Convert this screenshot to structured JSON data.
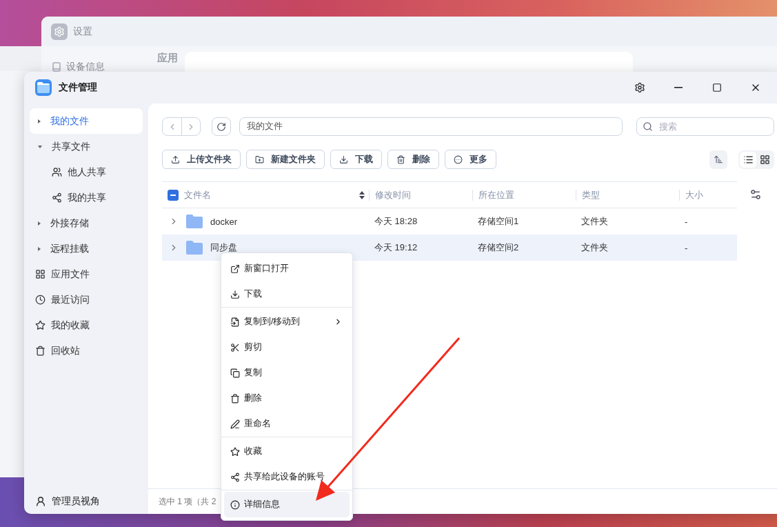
{
  "background_window": {
    "title": "设置",
    "sidebar_item": "设备信息",
    "heading": "应用"
  },
  "window": {
    "title": "文件管理"
  },
  "sidebar": {
    "items": [
      {
        "label": "我的文件",
        "kind": "group",
        "selected": true,
        "expanded": false
      },
      {
        "label": "共享文件",
        "kind": "group",
        "selected": false,
        "expanded": true,
        "children": [
          {
            "label": "他人共享",
            "selected": false
          },
          {
            "label": "我的共享",
            "selected": false
          }
        ]
      },
      {
        "label": "外接存储",
        "kind": "group",
        "selected": false,
        "expanded": false
      },
      {
        "label": "远程挂载",
        "kind": "group",
        "selected": false,
        "expanded": false
      },
      {
        "label": "应用文件",
        "kind": "link",
        "selected": false
      },
      {
        "label": "最近访问",
        "kind": "link",
        "selected": false
      },
      {
        "label": "我的收藏",
        "kind": "link",
        "selected": false
      },
      {
        "label": "回收站",
        "kind": "link",
        "selected": false
      }
    ],
    "footer": "管理员视角"
  },
  "path_field": {
    "value": "我的文件"
  },
  "search": {
    "placeholder": "搜索"
  },
  "toolbar": [
    "上传文件夹",
    "新建文件夹",
    "下载",
    "删除",
    "更多"
  ],
  "view_modes": [
    {
      "kind": "list",
      "selected": true
    },
    {
      "kind": "grid",
      "selected": false
    }
  ],
  "table": {
    "select_all": {
      "indeterminate": true
    },
    "columns": [
      "文件名",
      "修改时间",
      "所在位置",
      "类型",
      "大小"
    ],
    "rows": [
      {
        "name": "docker",
        "modified": "今天 18:28",
        "location": "存储空间1",
        "type": "文件夹",
        "size": "-",
        "selected": false
      },
      {
        "name": "同步盘",
        "modified": "今天 19:12",
        "location": "存储空间2",
        "type": "文件夹",
        "size": "-",
        "selected": true
      }
    ]
  },
  "status_bar": "选中 1 项（共 2",
  "context_menu": {
    "groups": [
      [
        {
          "label": "新窗口打开",
          "submenu": false,
          "selected": false
        },
        {
          "label": "下载",
          "submenu": false,
          "selected": false
        }
      ],
      [
        {
          "label": "复制到/移动到",
          "submenu": true,
          "selected": false
        },
        {
          "label": "剪切",
          "submenu": false,
          "selected": false
        },
        {
          "label": "复制",
          "submenu": false,
          "selected": false
        },
        {
          "label": "删除",
          "submenu": false,
          "selected": false
        },
        {
          "label": "重命名",
          "submenu": false,
          "selected": false
        }
      ],
      [
        {
          "label": "收藏",
          "submenu": false,
          "selected": false
        },
        {
          "label": "共享给此设备的账号",
          "submenu": false,
          "selected": false
        }
      ],
      [
        {
          "label": "详细信息",
          "submenu": false,
          "selected": true
        }
      ]
    ]
  }
}
